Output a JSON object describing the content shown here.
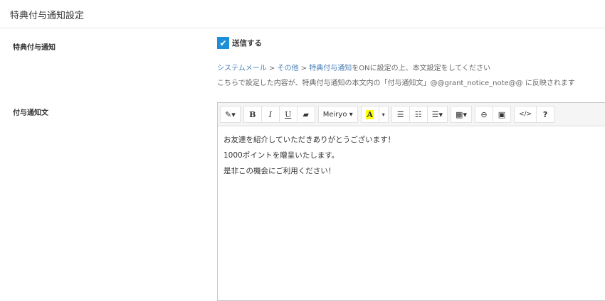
{
  "header": {
    "title": "特典付与通知設定"
  },
  "notice": {
    "label": "特典付与通知",
    "checkbox_label": "送信する",
    "checked": true,
    "breadcrumb": [
      "システムメール",
      "その他",
      "特典付与通知"
    ],
    "breadcrumb_sep": ">",
    "hint1_suffix": "をONに設定の上、本文設定をしてください",
    "hint2": "こちらで設定した内容が、特典付与通知の本文内の「付与通知文」@@grant_notice_note@@ に反映されます"
  },
  "body": {
    "label": "付与通知文",
    "toolbar": {
      "magic": "✎▾",
      "bold": "B",
      "italic": "I",
      "underline": "U",
      "eraser": "▰",
      "font": "Meiryo ▾",
      "color": "A",
      "color_caret": "▾",
      "ul": "☰",
      "ol": "☷",
      "align": "☰▾",
      "table": "▦▾",
      "link": "⊖",
      "image": "▣",
      "code": "</>",
      "help": "?"
    },
    "lines": [
      "お友達を紹介していただきありがとうございます！",
      "1000ポイントを贈呈いたします。",
      "是非この機会にご利用ください！"
    ]
  }
}
